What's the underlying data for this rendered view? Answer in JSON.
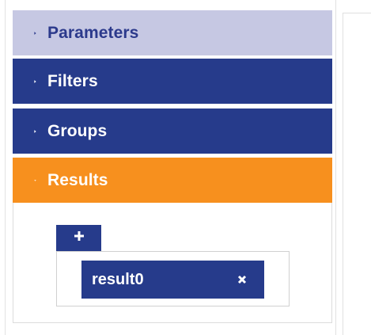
{
  "accordion": {
    "parameters": {
      "label": "Parameters",
      "icon": "caret-right-icon",
      "state": "collapsed",
      "color": "#c6c8e3",
      "text_color": "#2c3a8c"
    },
    "filters": {
      "label": "Filters",
      "icon": "caret-right-icon",
      "state": "collapsed",
      "color": "#263b8b"
    },
    "groups": {
      "label": "Groups",
      "icon": "caret-right-icon",
      "state": "collapsed",
      "color": "#263b8b"
    },
    "results": {
      "label": "Results",
      "icon": "caret-down-icon",
      "state": "expanded",
      "color": "#f7901e"
    }
  },
  "results_panel": {
    "add_icon": "plus-icon",
    "items": [
      {
        "label": "result0",
        "remove_icon": "close-icon"
      }
    ]
  }
}
